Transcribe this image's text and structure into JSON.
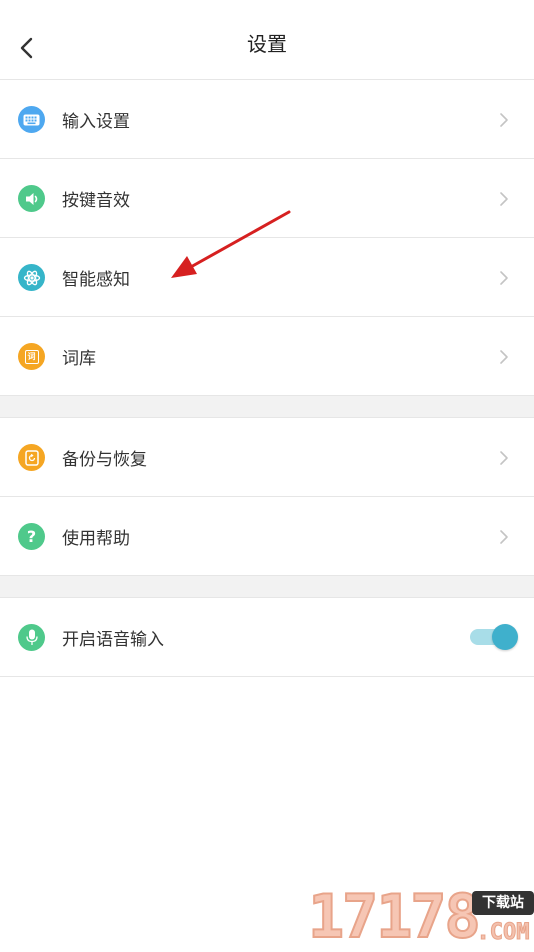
{
  "header": {
    "title": "设置",
    "back_icon": "chevron-left-icon"
  },
  "colors": {
    "keyboard": "#4ea8f0",
    "sound": "#4fc98b",
    "smart": "#36b5c9",
    "dict": "#f5a623",
    "backup": "#f5a623",
    "help": "#4fc98b",
    "voice": "#4fc98b",
    "toggle_on": "#3fb0cc",
    "annotation_arrow": "#d62020"
  },
  "groups": [
    {
      "items": [
        {
          "label": "输入设置",
          "icon": "keyboard-icon"
        },
        {
          "label": "按键音效",
          "icon": "speaker-icon"
        },
        {
          "label": "智能感知",
          "icon": "atom-icon"
        },
        {
          "label": "词库",
          "icon": "dictionary-icon",
          "icon_text": "词"
        }
      ]
    },
    {
      "items": [
        {
          "label": "备份与恢复",
          "icon": "backup-icon"
        },
        {
          "label": "使用帮助",
          "icon": "help-icon",
          "icon_text": "?"
        }
      ]
    },
    {
      "items": [
        {
          "label": "开启语音输入",
          "icon": "microphone-icon",
          "toggle": true
        }
      ]
    }
  ],
  "watermark": {
    "digits": "17178",
    "badge": "下载站",
    "suffix": ".COM"
  }
}
